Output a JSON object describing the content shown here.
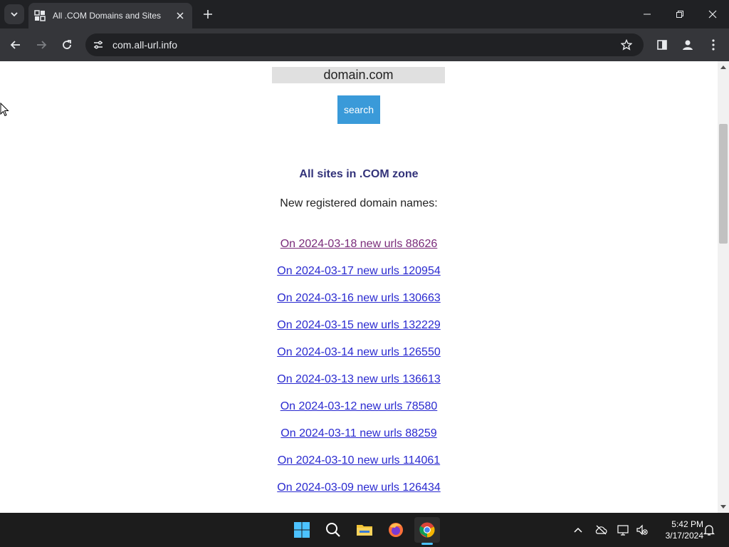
{
  "browser": {
    "tab_title": "All .COM Domains and Sites",
    "url": "com.all-url.info"
  },
  "page": {
    "search_value": "domain.com",
    "search_button": "search",
    "heading": "All sites in .COM zone",
    "subheading": "New registered domain names:",
    "links": [
      {
        "label": "On 2024-03-18 new urls 88626",
        "visited": true
      },
      {
        "label": "On 2024-03-17 new urls 120954",
        "visited": false
      },
      {
        "label": "On 2024-03-16 new urls 130663",
        "visited": false
      },
      {
        "label": "On 2024-03-15 new urls 132229",
        "visited": false
      },
      {
        "label": "On 2024-03-14 new urls 126550",
        "visited": false
      },
      {
        "label": "On 2024-03-13 new urls 136613",
        "visited": false
      },
      {
        "label": "On 2024-03-12 new urls 78580",
        "visited": false
      },
      {
        "label": "On 2024-03-11 new urls 88259",
        "visited": false
      },
      {
        "label": "On 2024-03-10 new urls 114061",
        "visited": false
      },
      {
        "label": "On 2024-03-09 new urls 126434",
        "visited": false
      }
    ]
  },
  "taskbar": {
    "time": "5:42 PM",
    "date": "3/17/2024"
  },
  "colors": {
    "accent_button": "#3a9ad9",
    "heading": "#33337a",
    "link": "#2a2ad0",
    "link_visited": "#7a2b7a"
  }
}
